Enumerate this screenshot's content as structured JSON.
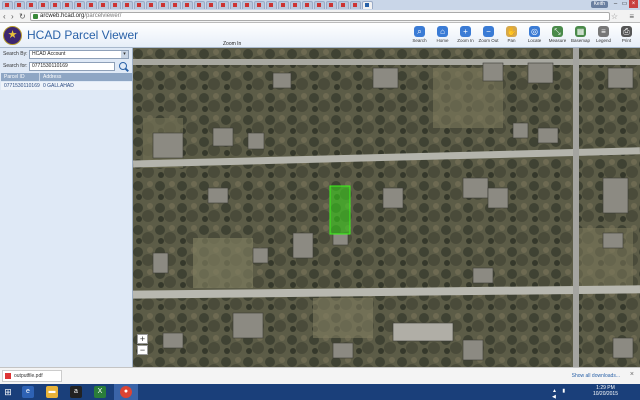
{
  "browser": {
    "url_host": "arcweb.hcad.org",
    "url_path": "/parcelviewer/",
    "user_badge": "Keith",
    "nav": {
      "back": "‹",
      "forward": "›",
      "reload": "↻"
    },
    "window_controls": {
      "minimize": "–",
      "maximize": "▭",
      "close": "×"
    }
  },
  "app": {
    "title": "HCAD Parcel Viewer",
    "logo_glyph": "★",
    "accent": "#2a62a8",
    "toolbar": [
      {
        "name": "search",
        "label": "Search",
        "icon": "search-icon",
        "color": "#3a7bd5",
        "glyph": "⌕"
      },
      {
        "name": "home",
        "label": "Home",
        "icon": "home-icon",
        "color": "#3a7bd5",
        "glyph": "⌂"
      },
      {
        "name": "zoom-in",
        "label": "Zoom In",
        "icon": "zoom-in-icon",
        "color": "#3a7bd5",
        "glyph": "+"
      },
      {
        "name": "zoom-out",
        "label": "Zoom Out",
        "icon": "zoom-out-icon",
        "color": "#3a7bd5",
        "glyph": "−"
      },
      {
        "name": "pan",
        "label": "Pan",
        "icon": "hand-icon",
        "color": "#d6a84a",
        "glyph": "✋"
      },
      {
        "name": "locate",
        "label": "Locate",
        "icon": "locate-icon",
        "color": "#3a7bd5",
        "glyph": "◎"
      },
      {
        "name": "measure",
        "label": "Measure",
        "icon": "measure-icon",
        "color": "#4a8a4a",
        "glyph": "⤡"
      },
      {
        "name": "basemap",
        "label": "Basemap",
        "icon": "basemap-icon",
        "color": "#4a8a4a",
        "glyph": "▦"
      },
      {
        "name": "legend",
        "label": "Legend",
        "icon": "legend-icon",
        "color": "#777777",
        "glyph": "≡"
      },
      {
        "name": "print",
        "label": "Print",
        "icon": "print-icon",
        "color": "#555555",
        "glyph": "⎙"
      }
    ]
  },
  "panel": {
    "search_by_label": "Search By:",
    "search_by_value": "HCAD Account",
    "search_for_label": "Search for:",
    "search_for_value": "0771530110169",
    "columns": [
      "Parcel ID",
      "Address"
    ],
    "rows": [
      {
        "parcel_id": "0771530110169",
        "address": "0 GALLAHAD"
      }
    ]
  },
  "map": {
    "zoom_label": "Zoom In",
    "zoom_in": "+",
    "zoom_out": "−",
    "highlight_color": "#39d81a"
  },
  "downloads": {
    "file": "outputfile.pdf",
    "show_all": "Show all downloads...",
    "close": "×"
  },
  "taskbar": {
    "time": "1:29 PM",
    "date": "10/20/2015",
    "tray": "▲ ▮ ◀"
  }
}
